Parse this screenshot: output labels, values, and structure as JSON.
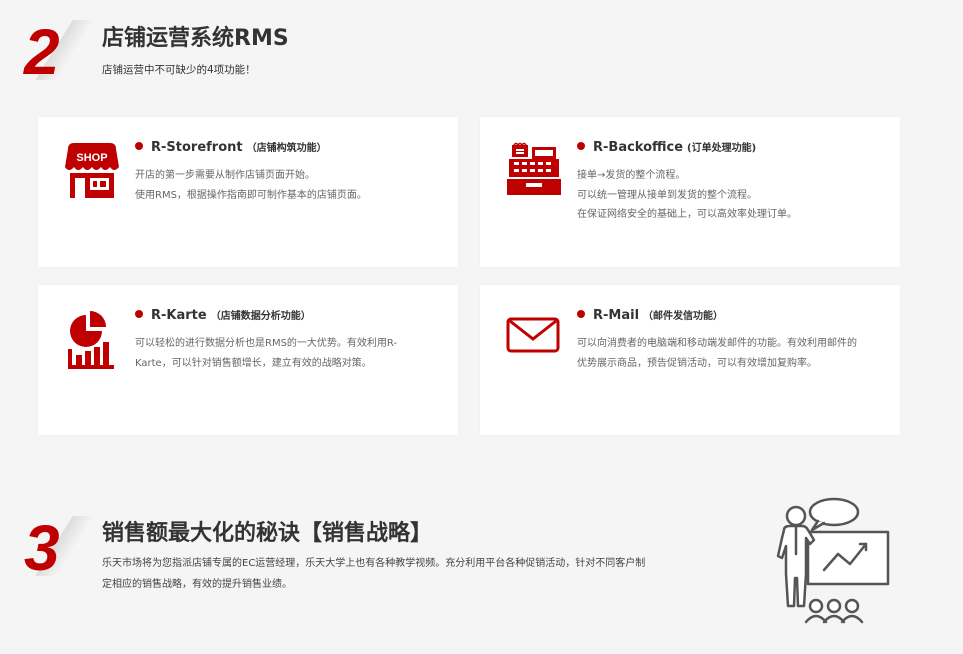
{
  "section2": {
    "number": "2",
    "title": "店铺运营系统RMS",
    "subtitle": "店铺运营中不可缺少的4项功能！"
  },
  "cards": [
    {
      "icon": "shop-icon",
      "title": "R-Storefront",
      "title_note": "（店铺构筑功能）",
      "desc": [
        "开店的第一步需要从制作店铺页面开始。",
        "使用RMS，根据操作指南即可制作基本的店铺页面。"
      ]
    },
    {
      "icon": "cash-register-icon",
      "title": "R-Backoffice",
      "title_note": "(订单处理功能)",
      "desc": [
        "接单→发货的整个流程。",
        "可以统一管理从接单到发货的整个流程。",
        "在保证网络安全的基础上，可以高效率处理订单。"
      ]
    },
    {
      "icon": "analytics-chart-icon",
      "title": "R-Karte",
      "title_note": "（店铺数据分析功能）",
      "desc": [
        "可以轻松的进行数据分析也是RMS的一大优势。有效利用R-",
        "Karte，可以针对销售额增长，建立有效的战略对策。"
      ]
    },
    {
      "icon": "mail-icon",
      "title": "R-Mail",
      "title_note": "（邮件发信功能）",
      "desc": [
        "可以向消费者的电脑端和移动端发邮件的功能。有效利用邮件的",
        "优势展示商品，预告促销活动，可以有效增加复购率。"
      ]
    }
  ],
  "shop_icon_text": "SHOP",
  "section3": {
    "number": "3",
    "title": "销售额最大化的秘诀【销售战略】",
    "desc": [
      "乐天市场将为您指派店铺专属的EC运营经理，乐天大学上也有各种教学视频。充分利用平台各种促销活动，针对不同客户制",
      "定相应的销售战略，有效的提升销售业绩。"
    ],
    "illustration": "presenter-icon"
  },
  "colors": {
    "accent": "#bf0000",
    "background": "#f5f5f5",
    "card": "#ffffff"
  }
}
